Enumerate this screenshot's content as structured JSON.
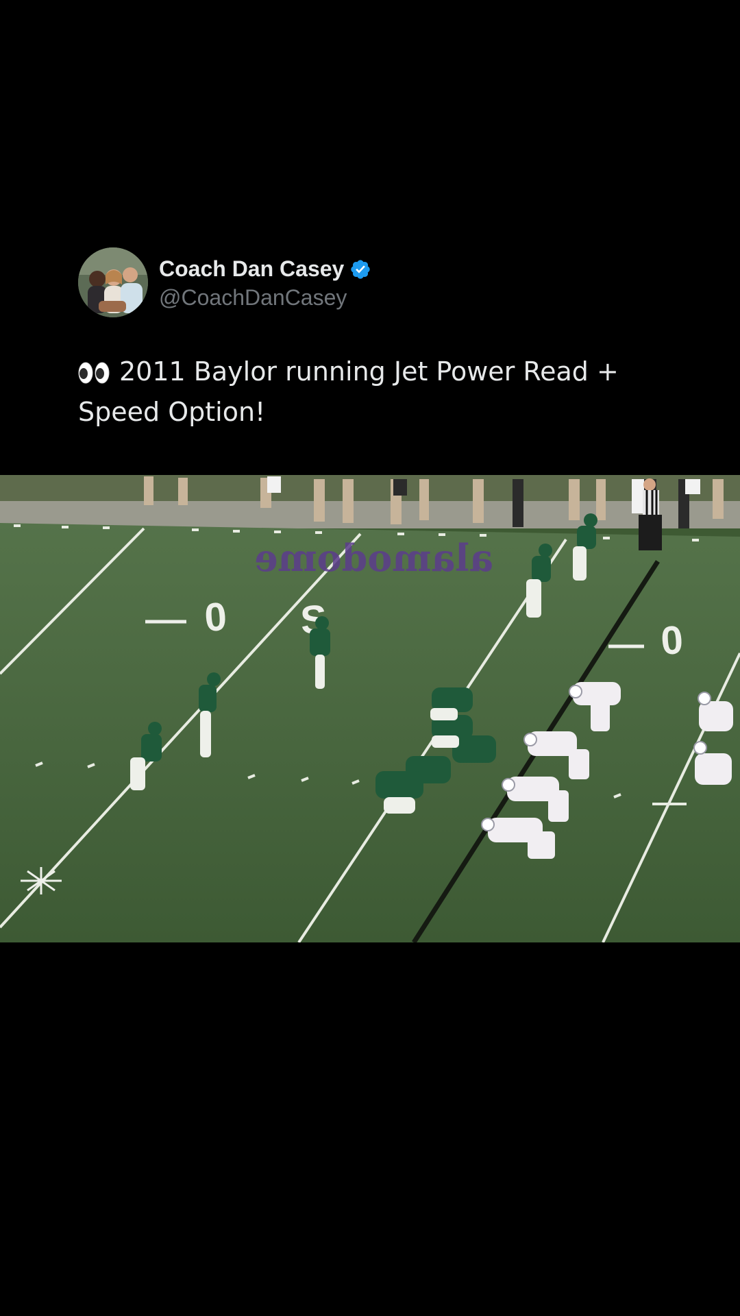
{
  "tweet": {
    "author": {
      "display_name": "Coach Dan Casey",
      "handle": "@CoachDanCasey",
      "verified": true,
      "avatar_icon": "profile-photo",
      "verified_icon": "verified-badge-icon"
    },
    "text": {
      "emoji": "👀",
      "body": "2011 Baylor running Jet Power Read + Speed Option!"
    },
    "media": {
      "type": "video-frame",
      "description_icon": "football-field-video",
      "field_marking": "alamodome",
      "yard_numbers": [
        "0",
        "0",
        "0"
      ]
    }
  },
  "colors": {
    "background": "#000000",
    "name": "#e7e9ea",
    "handle": "#71767b",
    "verified": "#1d9bf0",
    "field": "#4a6b3c",
    "home_team": "#1f5a3a",
    "away_team": "#f1eef2"
  }
}
